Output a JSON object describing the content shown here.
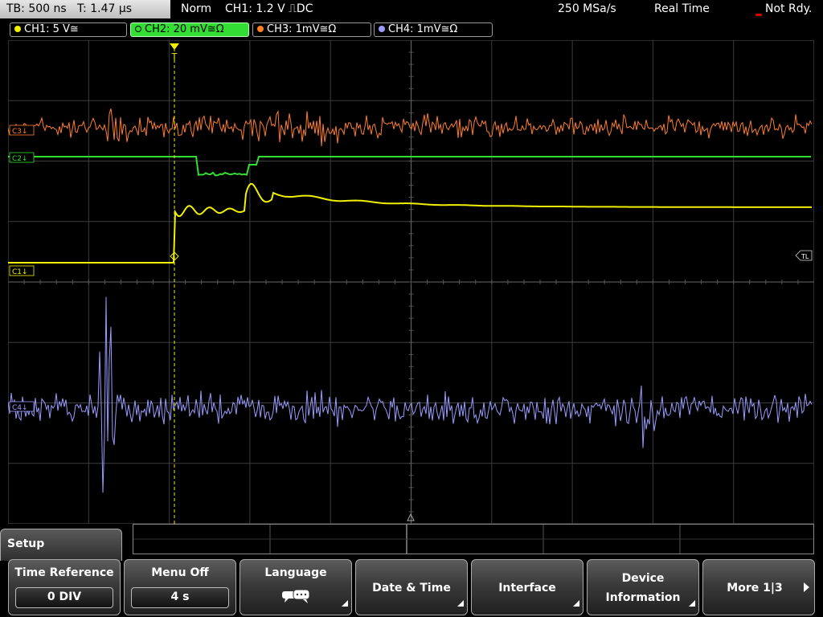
{
  "status": {
    "timebase": "TB: 500 ns",
    "time_offset": "T: 1.47 µs",
    "mode": "Norm",
    "trigger": "CH1: 1.2 V ⎍DC",
    "sample_rate": "250 MSa/s",
    "acq_mode": "Real Time",
    "ready": "Not Rdy."
  },
  "channel_tabs": [
    {
      "label": "CH1: 5 V≅",
      "color": "#f0f000"
    },
    {
      "label": "CH2: 20 mV≅Ω",
      "color": "#33dd33"
    },
    {
      "label": "CH3: 1mV≅Ω",
      "color": "#ff7f27"
    },
    {
      "label": "CH4: 1mV≅Ω",
      "color": "#9b9bff"
    }
  ],
  "markers": {
    "ch1": "C1↓",
    "ch2": "C2↓",
    "ch3": "C3↓",
    "ch4": "C4↓",
    "trigger_level": "TL",
    "trigger_pos": "T"
  },
  "menu": {
    "title": "Setup",
    "keys": [
      {
        "label": "Time Reference",
        "value": "0 DIV"
      },
      {
        "label": "Menu Off",
        "value": "4 s"
      },
      {
        "label": "Language",
        "icon": "speech-bubbles-icon"
      },
      {
        "label": "Date & Time"
      },
      {
        "label": "Interface"
      },
      {
        "label_line1": "Device",
        "label_line2": "Information"
      },
      {
        "label": "More 1|3"
      }
    ]
  },
  "colors": {
    "ch1": "#f0f000",
    "ch2": "#33dd33",
    "ch3": "#ff7f27",
    "ch4": "#9b9bff",
    "grid": "#4a4a4a",
    "trigger_marker": "#f0f000"
  }
}
